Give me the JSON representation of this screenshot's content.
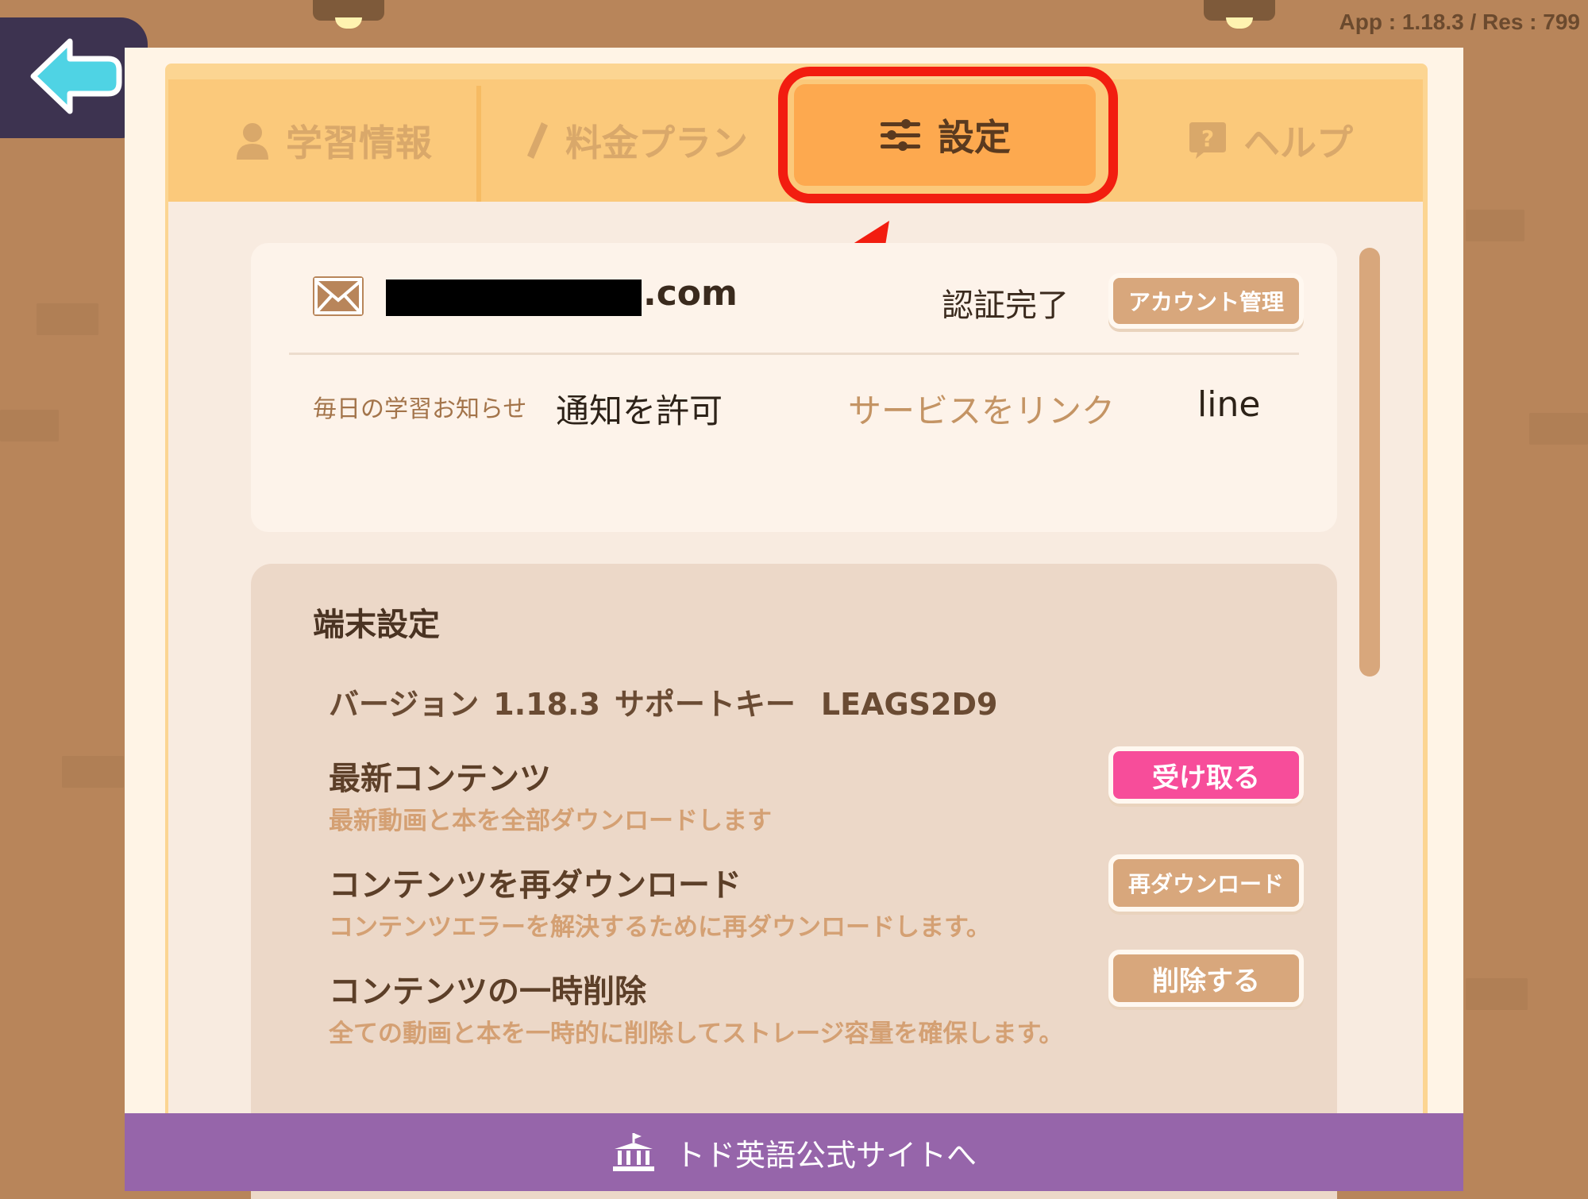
{
  "version_info": "App : 1.18.3 / Res : 799",
  "tabs": [
    {
      "label": "学習情報",
      "icon": "person-icon"
    },
    {
      "label": "料金プラン",
      "icon": "pen-icon"
    },
    {
      "label": "設定",
      "icon": "sliders-icon",
      "active": true
    },
    {
      "label": "ヘルプ",
      "icon": "help-bubble-icon"
    }
  ],
  "account": {
    "email_suffix": ".com",
    "auth_status": "認証完了",
    "manage_button": "アカウント管理",
    "notify_label": "毎日の学習お知らせ",
    "notify_value": "通知を許可",
    "service_label": "サービスをリンク",
    "service_value": "line"
  },
  "device": {
    "title": "端末設定",
    "version_label": "バージョン",
    "version_value": "1.18.3",
    "support_label": "サポートキー",
    "support_value": "LEAGS2D9",
    "items": [
      {
        "title": "最新コンテンツ",
        "desc": "最新動画と本を全部ダウンロードします",
        "button": "受け取る"
      },
      {
        "title": "コンテンツを再ダウンロード",
        "desc": "コンテンツエラーを解決するために再ダウンロードします。",
        "button": "再ダウンロード"
      },
      {
        "title": "コンテンツの一時削除",
        "desc": "全ての動画と本を一時的に削除してストレージ容量を確保します。",
        "button": "削除する"
      }
    ]
  },
  "footer": {
    "label": "トド英語公式サイトへ"
  },
  "colors": {
    "highlight": "#f21d10",
    "accent": "#fda94f",
    "pink_button": "#f74d9a",
    "footer": "#9665aa"
  }
}
